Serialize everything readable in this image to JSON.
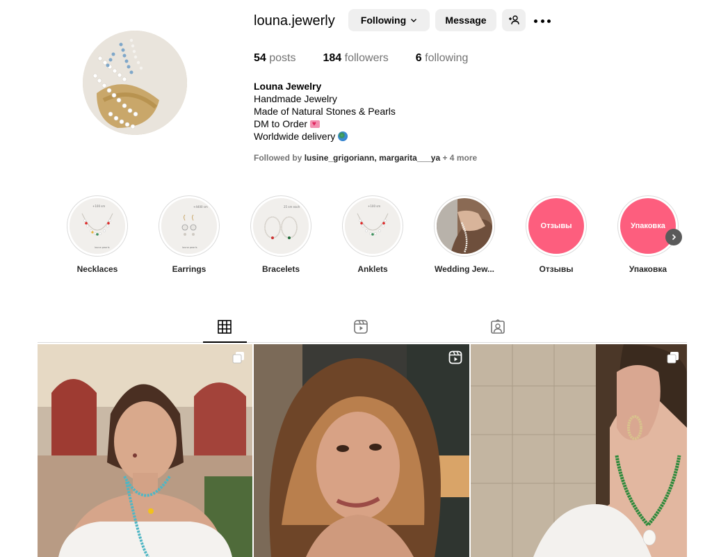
{
  "profile": {
    "username": "louna.jewerly",
    "following_label": "Following",
    "message_label": "Message",
    "stats": [
      {
        "num": "54",
        "label": "posts"
      },
      {
        "num": "184",
        "label": "followers"
      },
      {
        "num": "6",
        "label": "following"
      }
    ],
    "bio": {
      "name": "Louna Jewelry",
      "line1": "Handmade Jewelry",
      "line2": "Made of Natural Stones & Pearls",
      "line3": "DM to Order",
      "line4": "Worldwide delivery"
    },
    "followed_by": {
      "prefix": "Followed by",
      "user1": "lusine_grigoriann",
      "user2": "margarita___ya",
      "suffix": "+ 4 more"
    }
  },
  "highlights": [
    {
      "label": "Necklaces",
      "icon": "necklace-card"
    },
    {
      "label": "Earrings",
      "icon": "earrings-card"
    },
    {
      "label": "Bracelets",
      "icon": "bracelets-card"
    },
    {
      "label": "Anklets",
      "icon": "anklets-card"
    },
    {
      "label": "Wedding Jew...",
      "icon": "wedding-photo"
    },
    {
      "label": "Отзывы",
      "cover_text": "Отзывы",
      "color": "#fd5e7e"
    },
    {
      "label": "Упаковка",
      "cover_text": "Упаковка",
      "color": "#fd5e7e"
    }
  ],
  "tabs": [
    {
      "name": "posts",
      "icon": "grid-icon",
      "active": true
    },
    {
      "name": "reels",
      "icon": "reels-icon",
      "active": false
    },
    {
      "name": "tagged",
      "icon": "tagged-icon",
      "active": false
    }
  ],
  "posts": [
    {
      "type": "carousel",
      "badge_icon": "carousel-icon"
    },
    {
      "type": "reel",
      "badge_icon": "reel-icon"
    },
    {
      "type": "carousel",
      "badge_icon": "carousel-icon"
    }
  ],
  "colors": {
    "button_bg": "#efefef",
    "secondary_text": "#737373",
    "highlight_pink": "#fd5e7e",
    "divider": "#dbdbdb"
  }
}
